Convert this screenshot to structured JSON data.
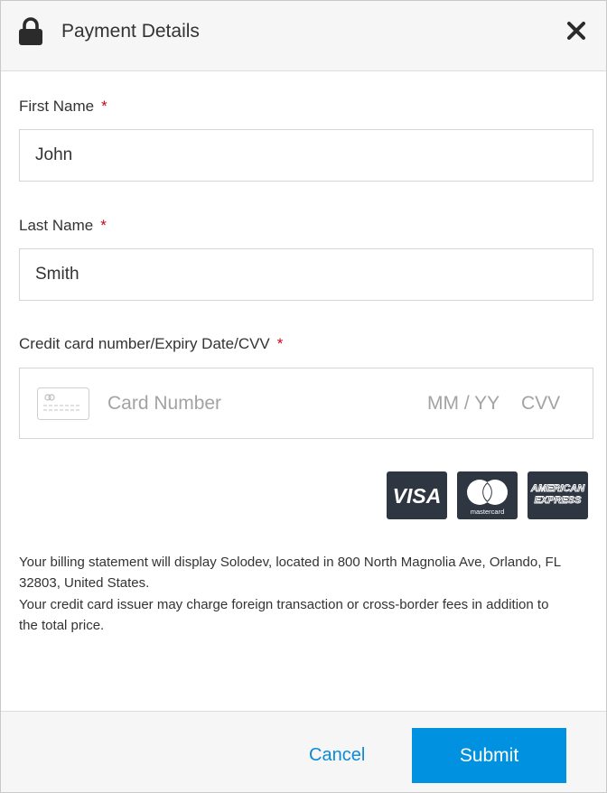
{
  "header": {
    "title": "Payment Details",
    "icon": "lock-icon",
    "close_icon": "close-icon"
  },
  "form": {
    "first_name": {
      "label": "First Name",
      "required_mark": "*",
      "value": "John"
    },
    "last_name": {
      "label": "Last Name",
      "required_mark": "*",
      "value": "Smith"
    },
    "card": {
      "label": "Credit card number/Expiry Date/CVV",
      "required_mark": "*",
      "number_placeholder": "Card Number",
      "expiry_placeholder": "MM / YY",
      "cvv_placeholder": "CVV",
      "icon": "credit-card-icon"
    }
  },
  "brands": {
    "visa": "VISA",
    "mastercard": "mastercard",
    "amex_line1": "AMERICAN",
    "amex_line2": "EXPRESS"
  },
  "notes": {
    "billing": "Your billing statement will display Solodev, located in 800 North Magnolia Ave, Orlando, FL 32803, United States.",
    "fees": "Your credit card issuer may charge foreign transaction or cross-border fees in addition to the total price."
  },
  "footer": {
    "cancel_label": "Cancel",
    "submit_label": "Submit"
  },
  "colors": {
    "accent": "#0092e0",
    "link": "#0b8ad6",
    "required": "#d0021b",
    "brand_bg": "#2e3641"
  }
}
